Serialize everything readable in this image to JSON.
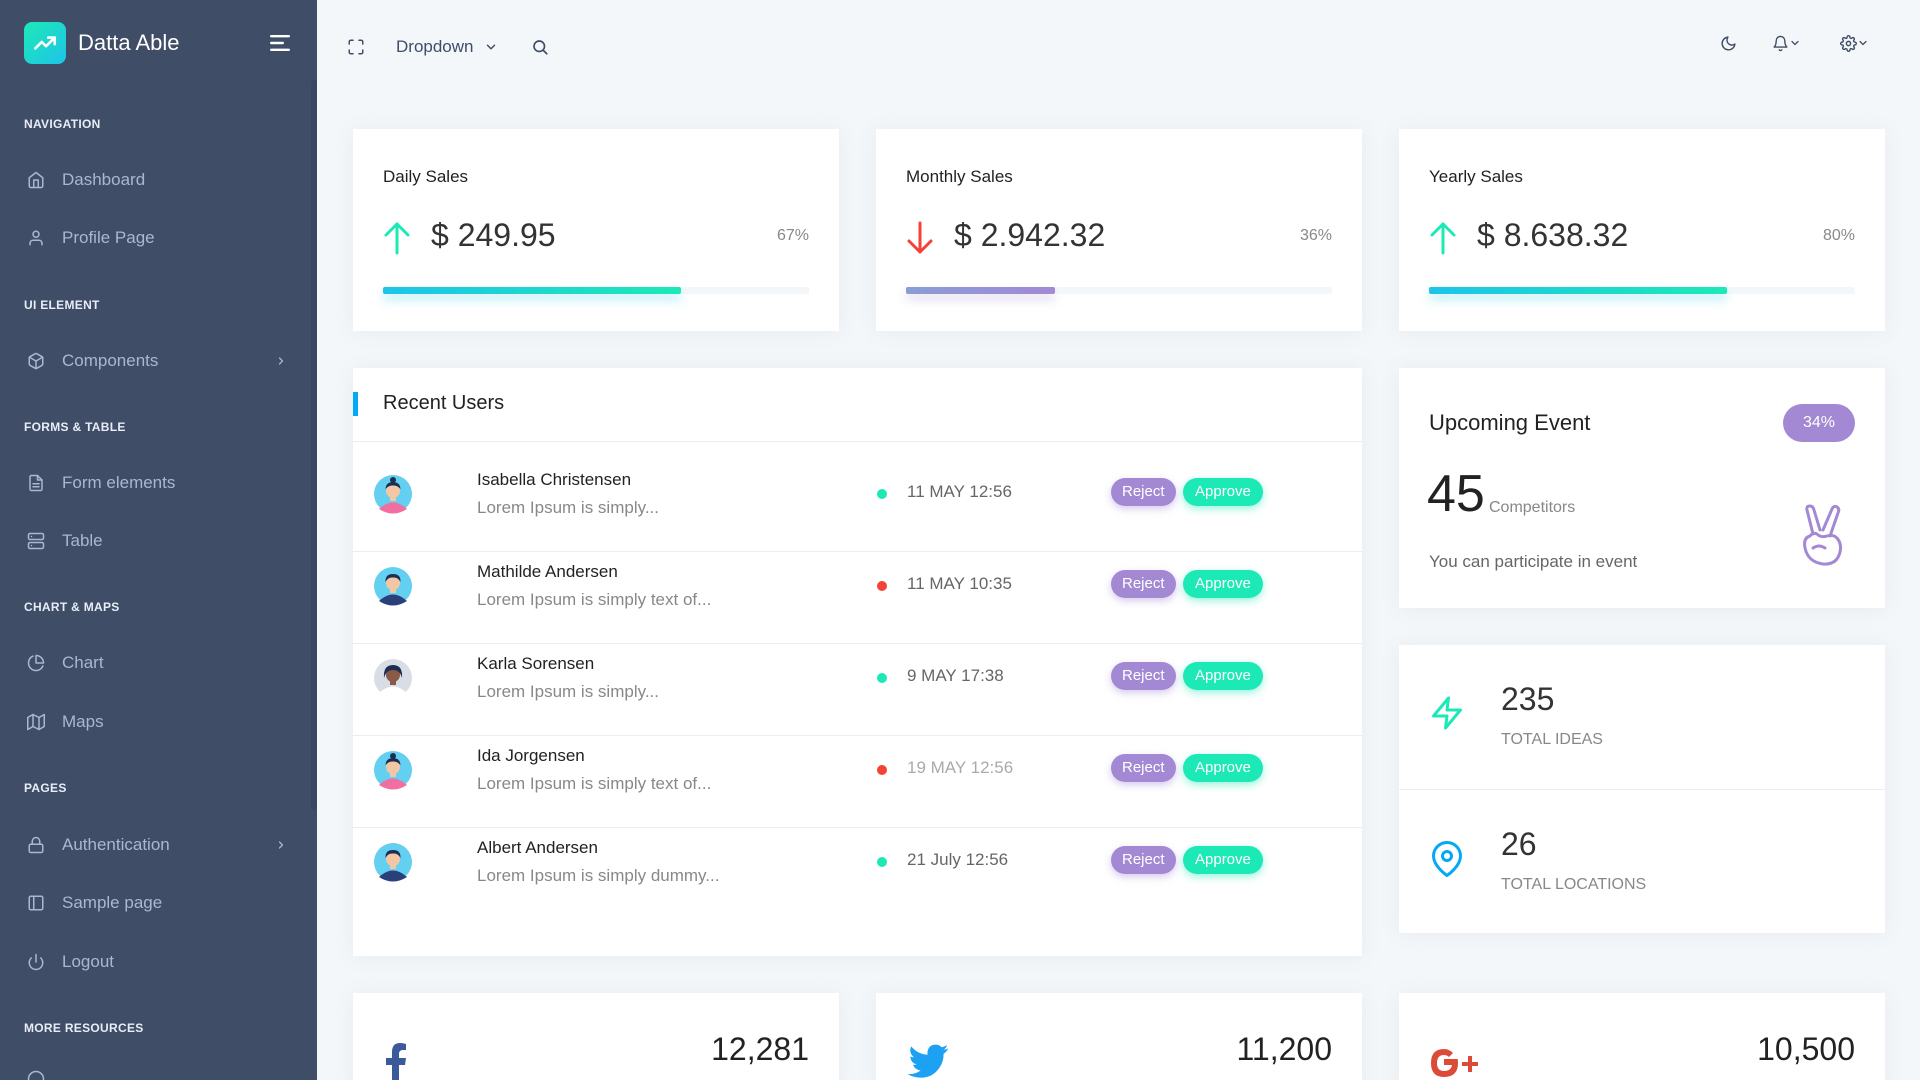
{
  "brand": {
    "name": "Datta Able",
    "logo_icon": "trend-up-icon"
  },
  "sidebar": {
    "sections": [
      {
        "caption": "NAVIGATION"
      },
      {
        "caption": "UI ELEMENT"
      },
      {
        "caption": "FORMS & TABLE"
      },
      {
        "caption": "CHART & MAPS"
      },
      {
        "caption": "PAGES"
      },
      {
        "caption": "MORE RESOURCES"
      }
    ],
    "items": [
      {
        "label": "Dashboard",
        "icon": "home-icon"
      },
      {
        "label": "Profile Page",
        "icon": "user-icon"
      },
      {
        "label": "Components",
        "icon": "box-icon",
        "has_submenu": true
      },
      {
        "label": "Form elements",
        "icon": "file-text-icon"
      },
      {
        "label": "Table",
        "icon": "server-icon"
      },
      {
        "label": "Chart",
        "icon": "pie-chart-icon"
      },
      {
        "label": "Maps",
        "icon": "map-icon"
      },
      {
        "label": "Authentication",
        "icon": "lock-icon",
        "has_submenu": true
      },
      {
        "label": "Sample page",
        "icon": "sidebar-icon"
      },
      {
        "label": "Logout",
        "icon": "power-icon"
      }
    ]
  },
  "header": {
    "dropdown_label": "Dropdown",
    "icons": [
      "fullscreen-icon",
      "chevron-down-icon",
      "search-icon",
      "moon-icon",
      "bell-icon",
      "settings-icon"
    ]
  },
  "sales": [
    {
      "title": "Daily Sales",
      "value": "$ 249.95",
      "percent": "67%",
      "direction": "up",
      "progress": 0.7
    },
    {
      "title": "Monthly Sales",
      "value": "$ 2.942.32",
      "percent": "36%",
      "direction": "down",
      "progress": 0.35
    },
    {
      "title": "Yearly Sales",
      "value": "$ 8.638.32",
      "percent": "80%",
      "direction": "up",
      "progress": 0.7
    }
  ],
  "recent_users": {
    "title": "Recent Users",
    "reject_label": "Reject",
    "approve_label": "Approve",
    "rows": [
      {
        "name": "Isabella Christensen",
        "desc": "Lorem Ipsum is simply...",
        "date": "11 MAY 12:56",
        "status": "green",
        "avatar": "female"
      },
      {
        "name": "Mathilde Andersen",
        "desc": "Lorem Ipsum is simply text of...",
        "date": "11 MAY 10:35",
        "status": "red",
        "avatar": "male"
      },
      {
        "name": "Karla Sorensen",
        "desc": "Lorem Ipsum is simply...",
        "date": "9 MAY 17:38",
        "status": "green",
        "avatar": "female-dark"
      },
      {
        "name": "Ida Jorgensen",
        "desc": "Lorem Ipsum is simply text of...",
        "date": "19 MAY 12:56",
        "status": "red",
        "avatar": "female"
      },
      {
        "name": "Albert Andersen",
        "desc": "Lorem Ipsum is simply dummy...",
        "date": "21 July 12:56",
        "status": "green",
        "avatar": "male"
      }
    ]
  },
  "upcoming_event": {
    "title": "Upcoming Event",
    "badge": "34%",
    "count": "45",
    "unit": "Competitors",
    "text": "You can participate in event",
    "icon": "peace-hand-icon"
  },
  "stats": [
    {
      "value": "235",
      "label": "TOTAL IDEAS",
      "icon": "zap-icon"
    },
    {
      "value": "26",
      "label": "TOTAL LOCATIONS",
      "icon": "map-pin-icon"
    }
  ],
  "social": [
    {
      "value": "12,281",
      "icon": "facebook-icon"
    },
    {
      "value": "11,200",
      "icon": "twitter-icon"
    },
    {
      "value": "10,500",
      "icon": "google-plus-icon"
    }
  ],
  "colors": {
    "sidebar_bg": "#3f4d67",
    "page_bg": "#f4f7fa",
    "green": "#1de9b6",
    "cyan": "#1dc4e9",
    "purple": "#a389d4",
    "red": "#f44236",
    "blue": "#04a9f5"
  }
}
